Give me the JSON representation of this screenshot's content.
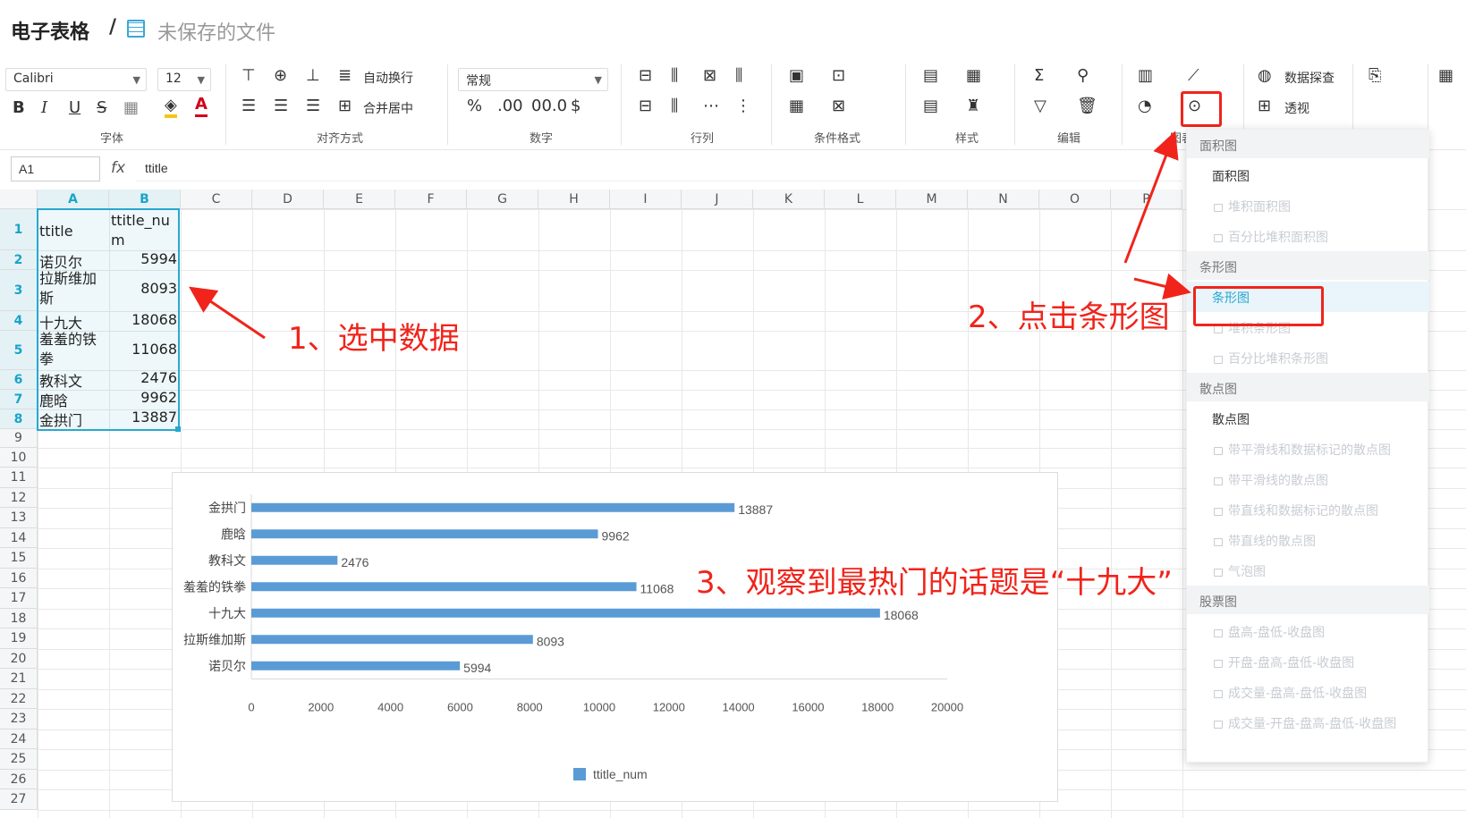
{
  "header": {
    "app_title": "电子表格",
    "separator": "/",
    "file_name": "未保存的文件"
  },
  "ribbon": {
    "font_name": "Calibri",
    "font_size": "12",
    "bold": "B",
    "italic": "I",
    "underline": "U",
    "strike": "S",
    "wrap_label": "自动换行",
    "merge_label": "合并居中",
    "number_format": "常规",
    "percent": "%",
    "dec_inc": ".00",
    "dec_dec": "00.0",
    "data_explore": "数据探查",
    "pivot": "透视",
    "groups": {
      "font": "字体",
      "align": "对齐方式",
      "number": "数字",
      "rowcol": "行列",
      "cond": "条件格式",
      "style": "样式",
      "edit": "编辑",
      "chart": "图表"
    }
  },
  "formula": {
    "cell_ref": "A1",
    "fx": "fx",
    "value": "ttitle"
  },
  "columns": [
    "A",
    "B",
    "C",
    "D",
    "E",
    "F",
    "G",
    "H",
    "I",
    "J",
    "K",
    "L",
    "M",
    "N",
    "O",
    "P"
  ],
  "rows": [
    "1",
    "2",
    "3",
    "4",
    "5",
    "6",
    "7",
    "8",
    "9",
    "10",
    "11",
    "12",
    "13",
    "14",
    "15",
    "16",
    "17",
    "18",
    "19",
    "20",
    "21",
    "22",
    "23",
    "24",
    "25",
    "26",
    "27"
  ],
  "cells": {
    "a1": "ttitle",
    "b1": "ttitle_num",
    "a2": "诺贝尔",
    "b2": "5994",
    "a3": "拉斯维加斯",
    "b3": "8093",
    "a4": "十九大",
    "b4": "18068",
    "a5": "羞羞的铁拳",
    "b5": "11068",
    "a6": "教科文",
    "b6": "2476",
    "a7": "鹿晗",
    "b7": "9962",
    "a8": "金拱门",
    "b8": "13887"
  },
  "chart_data": {
    "type": "bar",
    "orientation": "horizontal",
    "categories": [
      "金拱门",
      "鹿晗",
      "教科文",
      "羞羞的铁拳",
      "十九大",
      "拉斯维加斯",
      "诺贝尔"
    ],
    "series": [
      {
        "name": "ttitle_num",
        "values": [
          13887,
          9962,
          2476,
          11068,
          18068,
          8093,
          5994
        ],
        "color": "#5b9bd5"
      }
    ],
    "xlim": [
      0,
      20000
    ],
    "x_ticks": [
      "0",
      "2000",
      "4000",
      "6000",
      "8000",
      "10000",
      "12000",
      "14000",
      "16000",
      "18000",
      "20000"
    ],
    "legend": "bottom",
    "grid": false
  },
  "dropdown": {
    "sections": [
      {
        "title": "面积图",
        "items": [
          {
            "label": "面积图",
            "state": "enabled"
          },
          {
            "label": "堆积面积图",
            "state": "locked"
          },
          {
            "label": "百分比堆积面积图",
            "state": "locked"
          }
        ]
      },
      {
        "title": "条形图",
        "items": [
          {
            "label": "条形图",
            "state": "active"
          },
          {
            "label": "堆积条形图",
            "state": "locked"
          },
          {
            "label": "百分比堆积条形图",
            "state": "locked"
          }
        ]
      },
      {
        "title": "散点图",
        "items": [
          {
            "label": "散点图",
            "state": "enabled"
          },
          {
            "label": "带平滑线和数据标记的散点图",
            "state": "locked"
          },
          {
            "label": "带平滑线的散点图",
            "state": "locked"
          },
          {
            "label": "带直线和数据标记的散点图",
            "state": "locked"
          },
          {
            "label": "带直线的散点图",
            "state": "locked"
          },
          {
            "label": "气泡图",
            "state": "locked"
          }
        ]
      },
      {
        "title": "股票图",
        "items": [
          {
            "label": "盘高-盘低-收盘图",
            "state": "locked"
          },
          {
            "label": "开盘-盘高-盘低-收盘图",
            "state": "locked"
          },
          {
            "label": "成交量-盘高-盘低-收盘图",
            "state": "locked"
          },
          {
            "label": "成交量-开盘-盘高-盘低-收盘图",
            "state": "locked"
          }
        ]
      }
    ]
  },
  "annotations": {
    "step1": "1、选中数据",
    "step2": "2、点击条形图",
    "step3": "3、观察到最热门的话题是“十九大”"
  },
  "colors": {
    "accent": "#27a8cf",
    "annotation": "#f0241b",
    "bar": "#5b9bd5"
  }
}
